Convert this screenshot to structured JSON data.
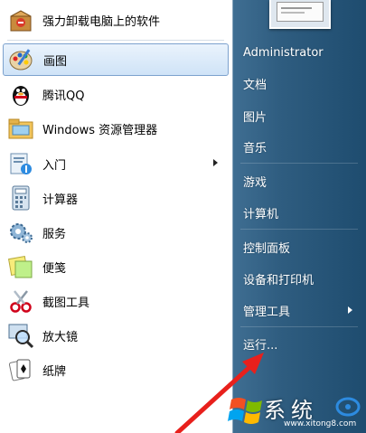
{
  "programs": [
    {
      "label": "强力卸载电脑上的软件",
      "icon": "uninstall-box-icon"
    },
    {
      "label": "画图",
      "icon": "paint-palette-icon",
      "selected": true
    },
    {
      "label": "腾讯QQ",
      "icon": "qq-penguin-icon"
    },
    {
      "label": "Windows 资源管理器",
      "icon": "explorer-folder-icon"
    },
    {
      "label": "入门",
      "icon": "getting-started-icon",
      "submenu": true
    },
    {
      "label": "计算器",
      "icon": "calculator-icon"
    },
    {
      "label": "服务",
      "icon": "services-gear-icon"
    },
    {
      "label": "便笺",
      "icon": "sticky-notes-icon"
    },
    {
      "label": "截图工具",
      "icon": "snipping-scissors-icon"
    },
    {
      "label": "放大镜",
      "icon": "magnifier-icon"
    },
    {
      "label": "纸牌",
      "icon": "solitaire-cards-icon"
    }
  ],
  "right_pane": {
    "user": "Administrator",
    "items": [
      {
        "label": "文档"
      },
      {
        "label": "图片"
      },
      {
        "label": "音乐"
      },
      {
        "label": "游戏"
      },
      {
        "label": "计算机"
      },
      {
        "label": "控制面板"
      },
      {
        "label": "设备和打印机"
      },
      {
        "label": "管理工具",
        "submenu": true
      },
      {
        "label": "运行..."
      }
    ]
  },
  "watermark": {
    "title": "系统",
    "url": "www.xitong8.com"
  },
  "colors": {
    "selection": "#cfe3f7",
    "right_pane": "#2f5d80",
    "annotation_arrow": "#e8201c"
  }
}
